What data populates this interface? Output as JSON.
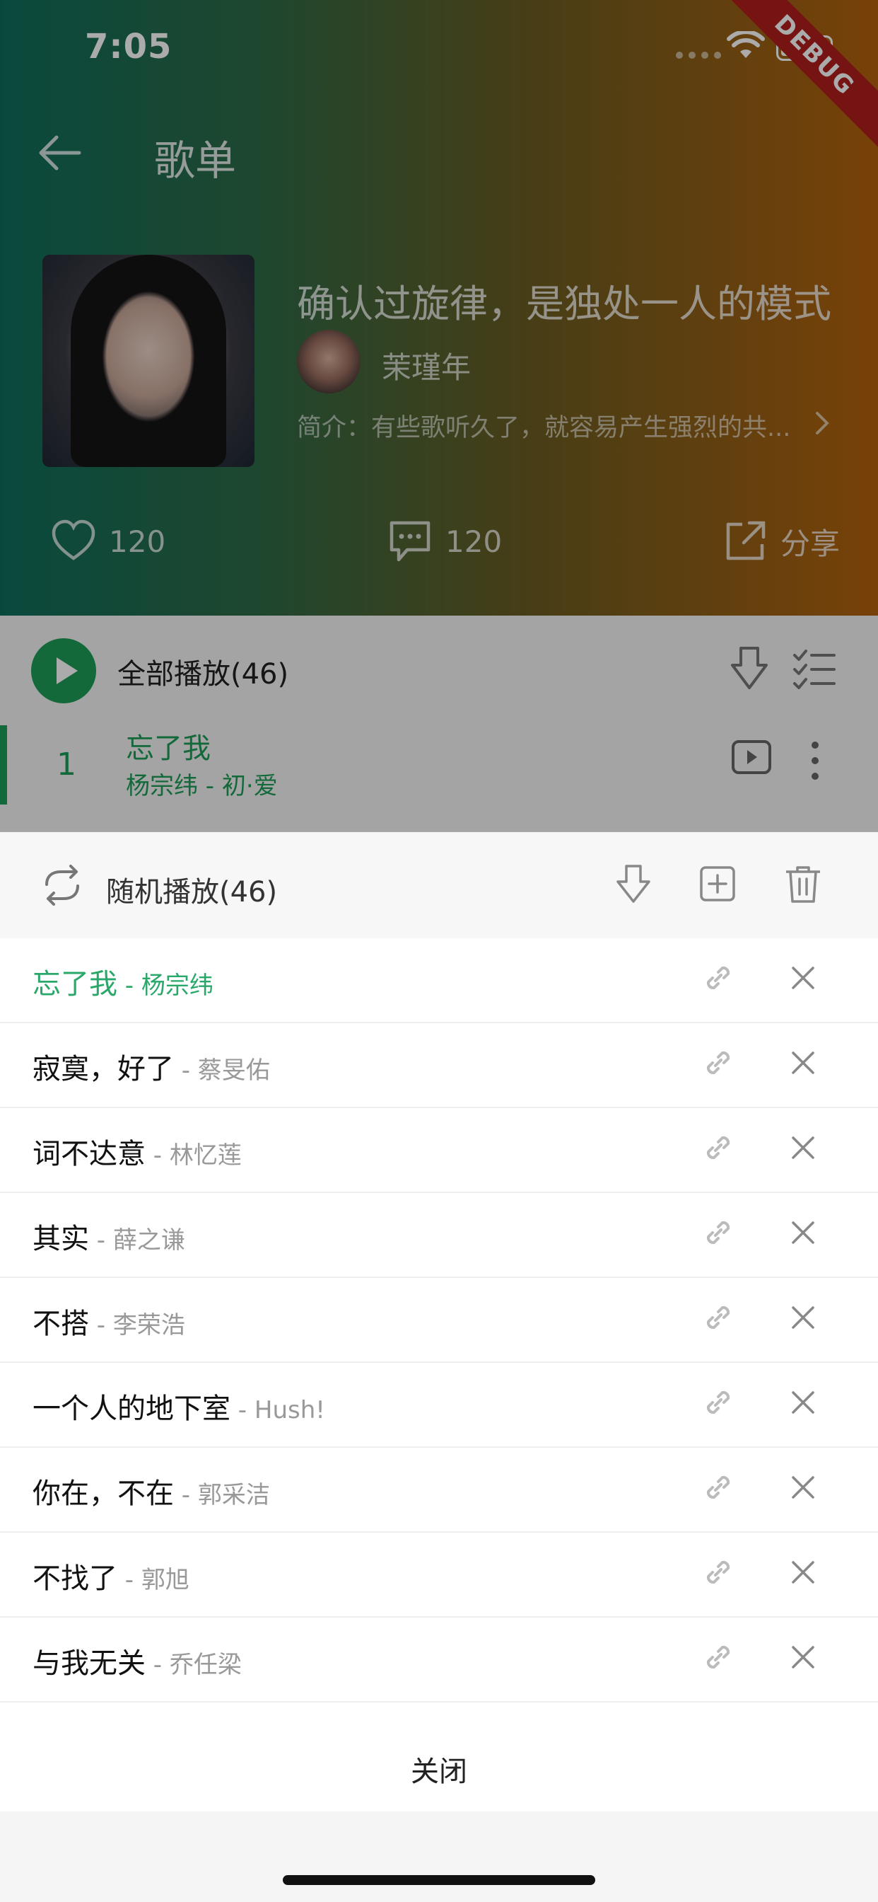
{
  "status_bar": {
    "time": "7:05",
    "debug_label": "DEBUG"
  },
  "nav": {
    "title": "歌单"
  },
  "playlist": {
    "title": "确认过旋律，是独处一人的模式",
    "creator": "茉瑾年",
    "intro": "简介：有些歌听久了，就容易产生强烈的共..."
  },
  "actions": {
    "likes": "120",
    "comments": "120",
    "share_label": "分享"
  },
  "list_header": {
    "play_all_label": "全部播放(46)"
  },
  "now_playing": {
    "index": "1",
    "song": "忘了我",
    "subtitle": "杨宗纬 - 初·爱"
  },
  "sheet": {
    "mode_label": "随机播放(46)",
    "close_label": "关闭",
    "items": [
      {
        "title": "忘了我",
        "artist": " - 杨宗纬",
        "current": true
      },
      {
        "title": "寂寞，好了",
        "artist": " - 蔡旻佑"
      },
      {
        "title": "词不达意",
        "artist": " - 林忆莲"
      },
      {
        "title": "其实",
        "artist": " - 薛之谦"
      },
      {
        "title": "不搭",
        "artist": " - 李荣浩"
      },
      {
        "title": "一个人的地下室",
        "artist": " - Hush!"
      },
      {
        "title": "你在，不在",
        "artist": " - 郭采洁"
      },
      {
        "title": "不找了",
        "artist": " - 郭旭"
      },
      {
        "title": "与我无关",
        "artist": " - 乔任梁"
      }
    ]
  },
  "colors": {
    "accent": "#1f9d58",
    "current_song": "#2aa86a",
    "gradient_start": "#0e6e5c",
    "gradient_end": "#b3620d"
  },
  "icons": [
    "back-arrow-icon",
    "heart-icon",
    "comment-icon",
    "share-icon",
    "play-icon",
    "download-icon",
    "multi-select-icon",
    "mv-icon",
    "more-vert-icon",
    "loop-icon",
    "add-icon",
    "trash-icon",
    "link-icon",
    "close-icon",
    "chevron-right-icon",
    "wifi-icon",
    "battery-icon"
  ]
}
